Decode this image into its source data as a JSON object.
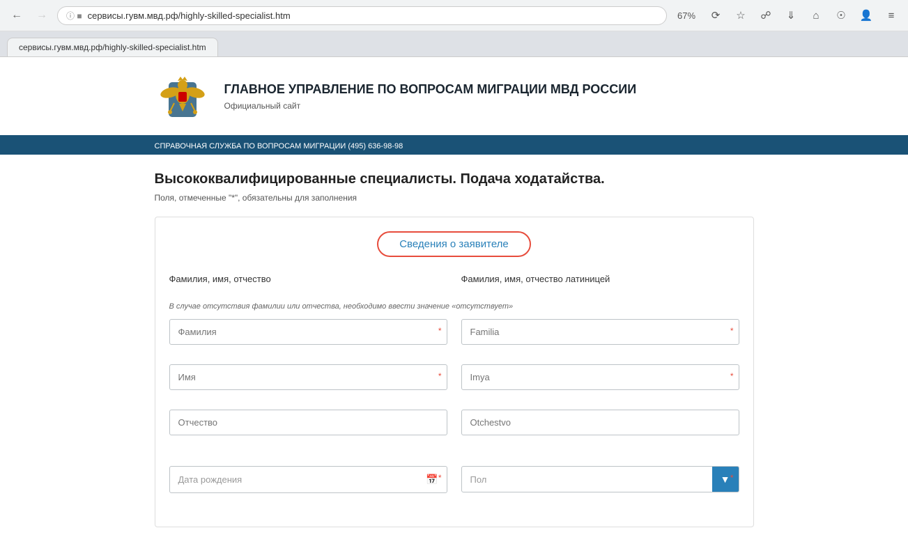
{
  "browser": {
    "tab_title": "сервисы.гувм.мвд.рф/highly-skilled-specialist.htm",
    "address": "сервисы.гувм.мвд.рф/highly-skilled-specialist.htm",
    "zoom": "67%",
    "back_label": "←",
    "forward_label": "→",
    "refresh_label": "↻",
    "home_label": "⌂"
  },
  "site": {
    "title": "ГЛАВНОЕ УПРАВЛЕНИЕ ПО ВОПРОСАМ МИГРАЦИИ МВД РОССИИ",
    "subtitle": "Официальный сайт",
    "info_bar": "СПРАВОЧНАЯ СЛУЖБА ПО ВОПРОСАМ МИГРАЦИИ (495) 636-98-98"
  },
  "page": {
    "title": "Высококвалифицированные специалисты. Подача ходатайства.",
    "subtitle": "Поля, отмеченные \"*\", обязательны для заполнения"
  },
  "form": {
    "section_title": "Сведения о заявителе",
    "left_group_label": "Фамилия, имя, отчество",
    "right_group_label": "Фамилия, имя, отчество латиницей",
    "note": "В случае отсутствия фамилии или отчества, необходимо ввести значение «отсутствует»",
    "fields": {
      "last_name": {
        "placeholder": "Фамилия",
        "required": true
      },
      "first_name": {
        "placeholder": "Имя",
        "required": true
      },
      "middle_name": {
        "placeholder": "Отчество",
        "required": false
      },
      "last_name_lat": {
        "placeholder": "Familia",
        "required": true
      },
      "first_name_lat": {
        "placeholder": "Imya",
        "required": true
      },
      "middle_name_lat": {
        "placeholder": "Otchestvo",
        "required": false
      },
      "birth_date": {
        "placeholder": "Дата рождения",
        "required": true
      },
      "gender": {
        "placeholder": "Пол",
        "required": true
      }
    }
  }
}
